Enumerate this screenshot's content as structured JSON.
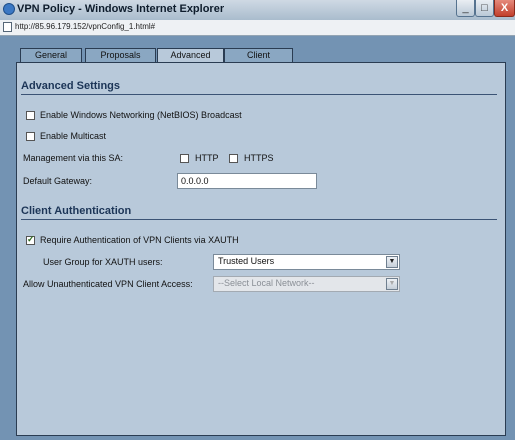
{
  "window": {
    "title": "VPN Policy - Windows Internet Explorer",
    "url": "http://85.96.179.152/vpnConfig_1.html#",
    "minimize_glyph": "_",
    "maximize_glyph": "□",
    "close_glyph": "X"
  },
  "tabs": [
    {
      "label": "General",
      "active": false
    },
    {
      "label": "Proposals",
      "active": false
    },
    {
      "label": "Advanced",
      "active": true
    },
    {
      "label": "Client",
      "active": false
    }
  ],
  "advanced_settings": {
    "title": "Advanced Settings",
    "netbios": {
      "label": "Enable Windows Networking (NetBIOS) Broadcast",
      "checked": false
    },
    "multicast": {
      "label": "Enable Multicast",
      "checked": false
    },
    "management": {
      "label": "Management via this SA:",
      "http": {
        "label": "HTTP",
        "checked": false
      },
      "https": {
        "label": "HTTPS",
        "checked": false
      }
    },
    "gateway": {
      "label": "Default Gateway:",
      "value": "0.0.0.0"
    }
  },
  "client_auth": {
    "title": "Client Authentication",
    "xauth": {
      "label": "Require Authentication of VPN Clients via XAUTH",
      "checked": true
    },
    "user_group": {
      "label": "User Group for XAUTH users:",
      "value": "Trusted Users"
    },
    "unauth_access": {
      "label": "Allow Unauthenticated VPN Client Access:",
      "value": "--Select Local Network--",
      "disabled": true
    }
  },
  "icons": {
    "app": "ie-icon",
    "page": "page-icon",
    "dropdown": "chevron-down-icon"
  }
}
